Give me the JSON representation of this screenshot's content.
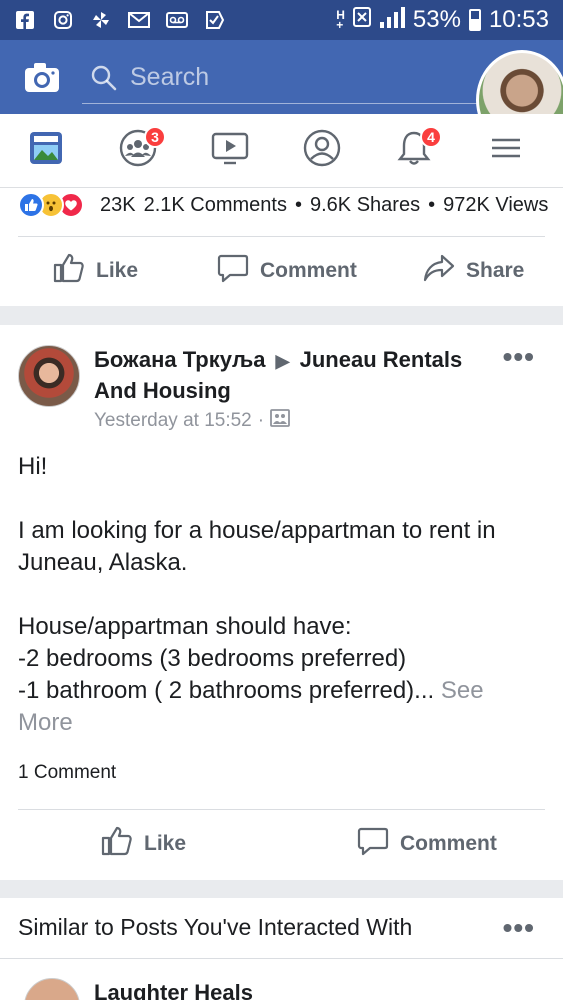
{
  "status_bar": {
    "left_icons": [
      "facebook-icon",
      "instagram-icon",
      "pinwheel-icon",
      "gmail-icon",
      "voicemail-icon",
      "check-icon"
    ],
    "battery": "53%",
    "battery_level": 0.53,
    "time": "10:53"
  },
  "search": {
    "placeholder": "Search"
  },
  "tabs": [
    {
      "name": "news-feed-icon",
      "badge": null
    },
    {
      "name": "groups-icon",
      "badge": "3"
    },
    {
      "name": "watch-icon",
      "badge": null
    },
    {
      "name": "profile-icon",
      "badge": null
    },
    {
      "name": "notifications-icon",
      "badge": "4"
    },
    {
      "name": "menu-icon",
      "badge": null
    }
  ],
  "post1": {
    "reaction_count": "23K",
    "comments": "2.1K Comments",
    "shares": "9.6K Shares",
    "views": "972K Views",
    "separator": "•",
    "like_label": "Like",
    "comment_label": "Comment",
    "share_label": "Share"
  },
  "post2": {
    "author": "Божана Тркуља",
    "group": "Juneau Rentals And Housing",
    "timestamp": "Yesterday at 15:52",
    "timestamp_separator": "·",
    "more": "•••",
    "body": {
      "greeting": "Hi!",
      "line1": "I am looking for a house/appartman to rent in Juneau, Alaska.",
      "line2": "House/appartman should have:",
      "line3": "-2 bedrooms (3 bedrooms preferred)",
      "line4": "-1 bathroom ( 2 bathrooms preferred)...",
      "see_more": "See More"
    },
    "comment_count": "1 Comment",
    "like_label": "Like",
    "comment_label": "Comment"
  },
  "similar": {
    "title": "Similar to Posts You've Interacted With",
    "more": "•••",
    "next_author": "Laughter Heals"
  }
}
